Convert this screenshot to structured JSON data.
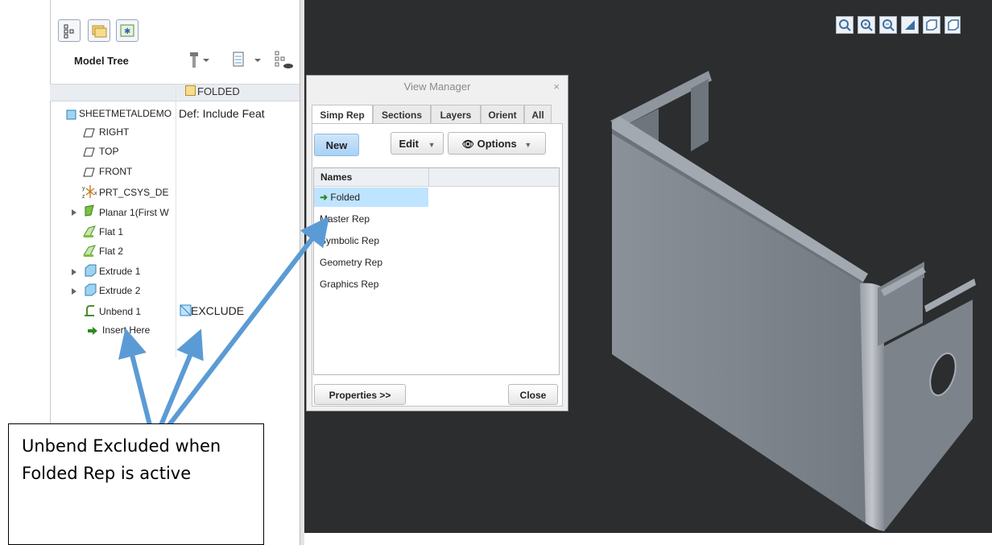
{
  "model_tree": {
    "title": "Model Tree",
    "column_header": "FOLDED",
    "root": {
      "name": "SHEETMETALDEMO",
      "value": "Def: Include Feat"
    },
    "items": [
      {
        "label": "RIGHT"
      },
      {
        "label": "TOP"
      },
      {
        "label": "FRONT"
      },
      {
        "label": "PRT_CSYS_DE"
      },
      {
        "label": "Planar 1(First W"
      },
      {
        "label": "Flat 1"
      },
      {
        "label": "Flat 2"
      },
      {
        "label": "Extrude 1"
      },
      {
        "label": "Extrude 2"
      },
      {
        "label": "Unbend 1",
        "status": "EXCLUDE"
      },
      {
        "label": "Insert Here"
      }
    ]
  },
  "view_manager": {
    "title": "View Manager",
    "close_x": "×",
    "tabs": [
      "Simp Rep",
      "Sections",
      "Layers",
      "Orient",
      "All"
    ],
    "active_tab": "Simp Rep",
    "buttons": {
      "new": "New",
      "edit": "Edit",
      "options": "Options"
    },
    "list_header": "Names",
    "reps": [
      "Folded",
      "Master Rep",
      "Symbolic Rep",
      "Geometry Rep",
      "Graphics Rep"
    ],
    "selected_rep": "Folded",
    "footer": {
      "properties": "Properties >>",
      "close": "Close"
    }
  },
  "callout": {
    "text": "Unbend Excluded when Folded Rep is active"
  },
  "colors": {
    "viewport_bg": "#2b2d2f",
    "selection": "#bfe4ff",
    "arrow": "#5b9bd5",
    "part": "#7f858c"
  }
}
